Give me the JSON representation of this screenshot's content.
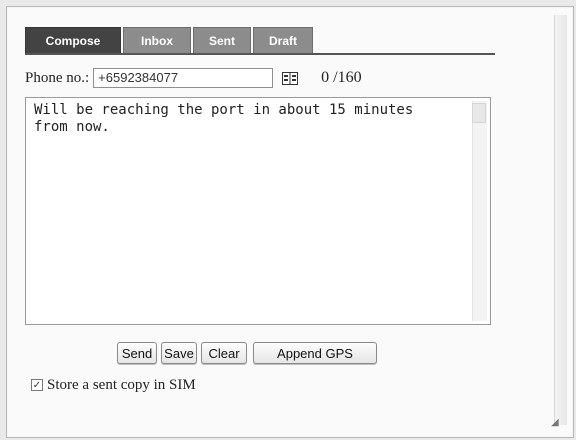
{
  "tabs": [
    {
      "label": "Compose",
      "active": true
    },
    {
      "label": "Inbox",
      "active": false
    },
    {
      "label": "Sent",
      "active": false
    },
    {
      "label": "Draft",
      "active": false
    }
  ],
  "phone": {
    "label": "Phone no.:",
    "value": "+6592384077"
  },
  "counter": "0 /160",
  "message": {
    "text": "Will be reaching the port in about 15 minutes\nfrom now."
  },
  "buttons": {
    "send": "Send",
    "save": "Save",
    "clear": "Clear",
    "append_gps": "Append GPS"
  },
  "store_copy": {
    "label": "Store a sent copy in SIM",
    "checked": true
  },
  "icons": {
    "address_book": "address-book-icon",
    "checkbox_mark": "check-icon"
  },
  "colors": {
    "active_tab": "#434343",
    "inactive_tab": "#8c8c8c",
    "background": "#fafafa"
  }
}
